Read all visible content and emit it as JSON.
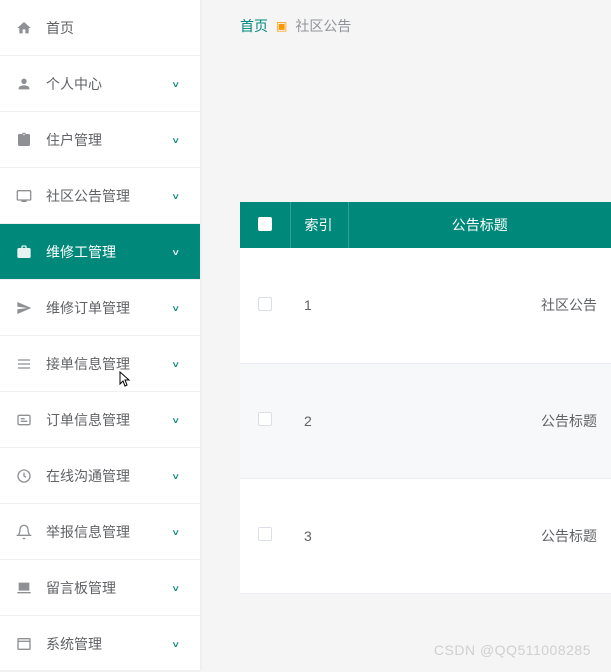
{
  "sidebar": {
    "items": [
      {
        "label": "首页",
        "icon": "home",
        "has_children": false,
        "active": false
      },
      {
        "label": "个人中心",
        "icon": "user",
        "has_children": true,
        "active": false
      },
      {
        "label": "住户管理",
        "icon": "clipboard",
        "has_children": true,
        "active": false
      },
      {
        "label": "社区公告管理",
        "icon": "monitor",
        "has_children": true,
        "active": false
      },
      {
        "label": "维修工管理",
        "icon": "toolbox",
        "has_children": true,
        "active": true
      },
      {
        "label": "维修订单管理",
        "icon": "send",
        "has_children": true,
        "active": false
      },
      {
        "label": "接单信息管理",
        "icon": "list",
        "has_children": true,
        "active": false
      },
      {
        "label": "订单信息管理",
        "icon": "message",
        "has_children": true,
        "active": false
      },
      {
        "label": "在线沟通管理",
        "icon": "clock",
        "has_children": true,
        "active": false
      },
      {
        "label": "举报信息管理",
        "icon": "bell",
        "has_children": true,
        "active": false
      },
      {
        "label": "留言板管理",
        "icon": "board",
        "has_children": true,
        "active": false
      },
      {
        "label": "系统管理",
        "icon": "browser",
        "has_children": true,
        "active": false
      }
    ]
  },
  "breadcrumb": {
    "home": "首页",
    "current": "社区公告"
  },
  "table": {
    "headers": {
      "index": "索引",
      "title": "公告标题"
    },
    "rows": [
      {
        "index": "1",
        "title": "社区公告"
      },
      {
        "index": "2",
        "title": "公告标题"
      },
      {
        "index": "3",
        "title": "公告标题"
      }
    ]
  },
  "watermark": "CSDN @QQ511008285"
}
